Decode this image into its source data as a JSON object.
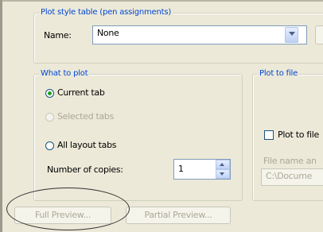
{
  "plot_style_table": {
    "legend": "Plot style table (pen assignments)",
    "name_label": "Name:",
    "name_value": "None"
  },
  "what_to_plot": {
    "legend": "What to plot",
    "options": [
      {
        "label": "Current tab",
        "checked": true,
        "enabled": true
      },
      {
        "label": "Selected tabs",
        "checked": false,
        "enabled": false
      },
      {
        "label": "All layout tabs",
        "checked": false,
        "enabled": true
      }
    ],
    "copies_label": "Number of copies:",
    "copies_value": "1"
  },
  "plot_to_file": {
    "legend": "Plot to file",
    "checkbox_label": "Plot to file",
    "checked": false,
    "filename_label": "File name an",
    "path_value": "C:\\Docume"
  },
  "buttons": {
    "full_preview": "Full Preview...",
    "partial_preview": "Partial Preview..."
  },
  "colors": {
    "group_title": "#0046d5",
    "window_bg": "#ece9d8",
    "disabled_text": "#aca899"
  },
  "icons": [
    "chevron-down-icon",
    "spin-up-icon",
    "spin-down-icon"
  ]
}
